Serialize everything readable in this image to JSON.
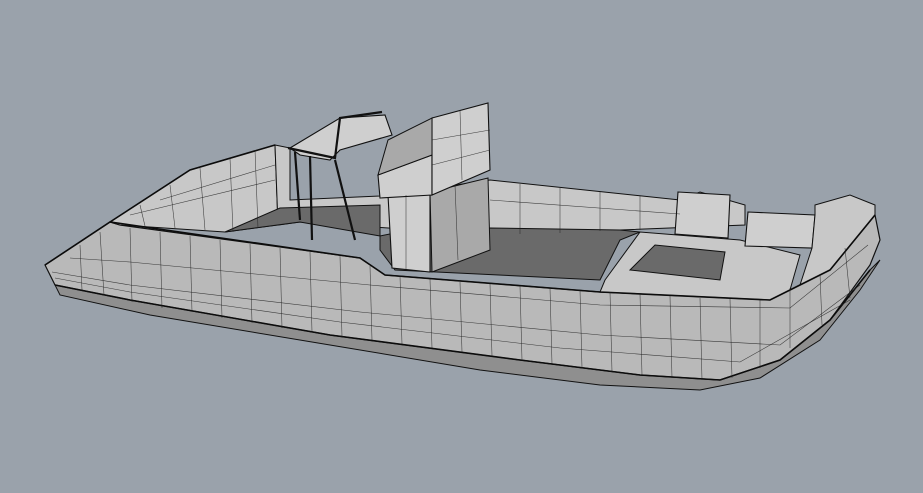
{
  "viewport": {
    "background": "#9aa2ab",
    "shading_mode": "wireframe-shaded",
    "object": "boat-hull-model"
  },
  "colors": {
    "surface": "#b9b9b9",
    "deck": "#6a6a6a",
    "wire": "#111111"
  }
}
